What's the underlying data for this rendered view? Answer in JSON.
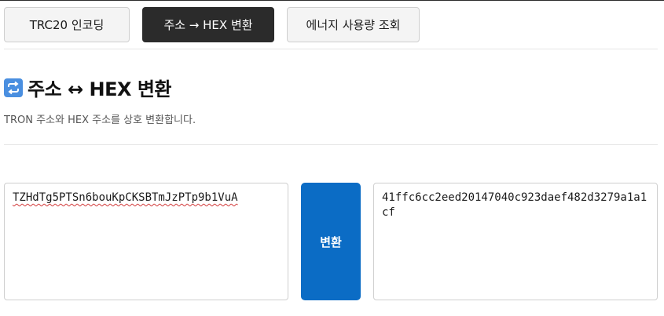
{
  "tabs": [
    {
      "label": "TRC20 인코딩",
      "active": false
    },
    {
      "label": "주소 → HEX 변환",
      "active": true
    },
    {
      "label": "에너지 사용량 조회",
      "active": false
    }
  ],
  "section": {
    "icon": "repeat-arrows-icon",
    "title": "주소 ↔ HEX 변환",
    "description": "TRON 주소와 HEX 주소를 상호 변환합니다."
  },
  "converter": {
    "address_value": "TZHdTg5PTSn6bouKpCKSBTmJzPTp9b1VuA",
    "button_label": "변환",
    "hex_value": "41ffc6cc2eed20147040c923daef482d3279a1a1cf"
  },
  "colors": {
    "accent": "#0b6cc5",
    "active_tab": "#2b2b2b",
    "icon_bg": "#4a8fe0"
  }
}
